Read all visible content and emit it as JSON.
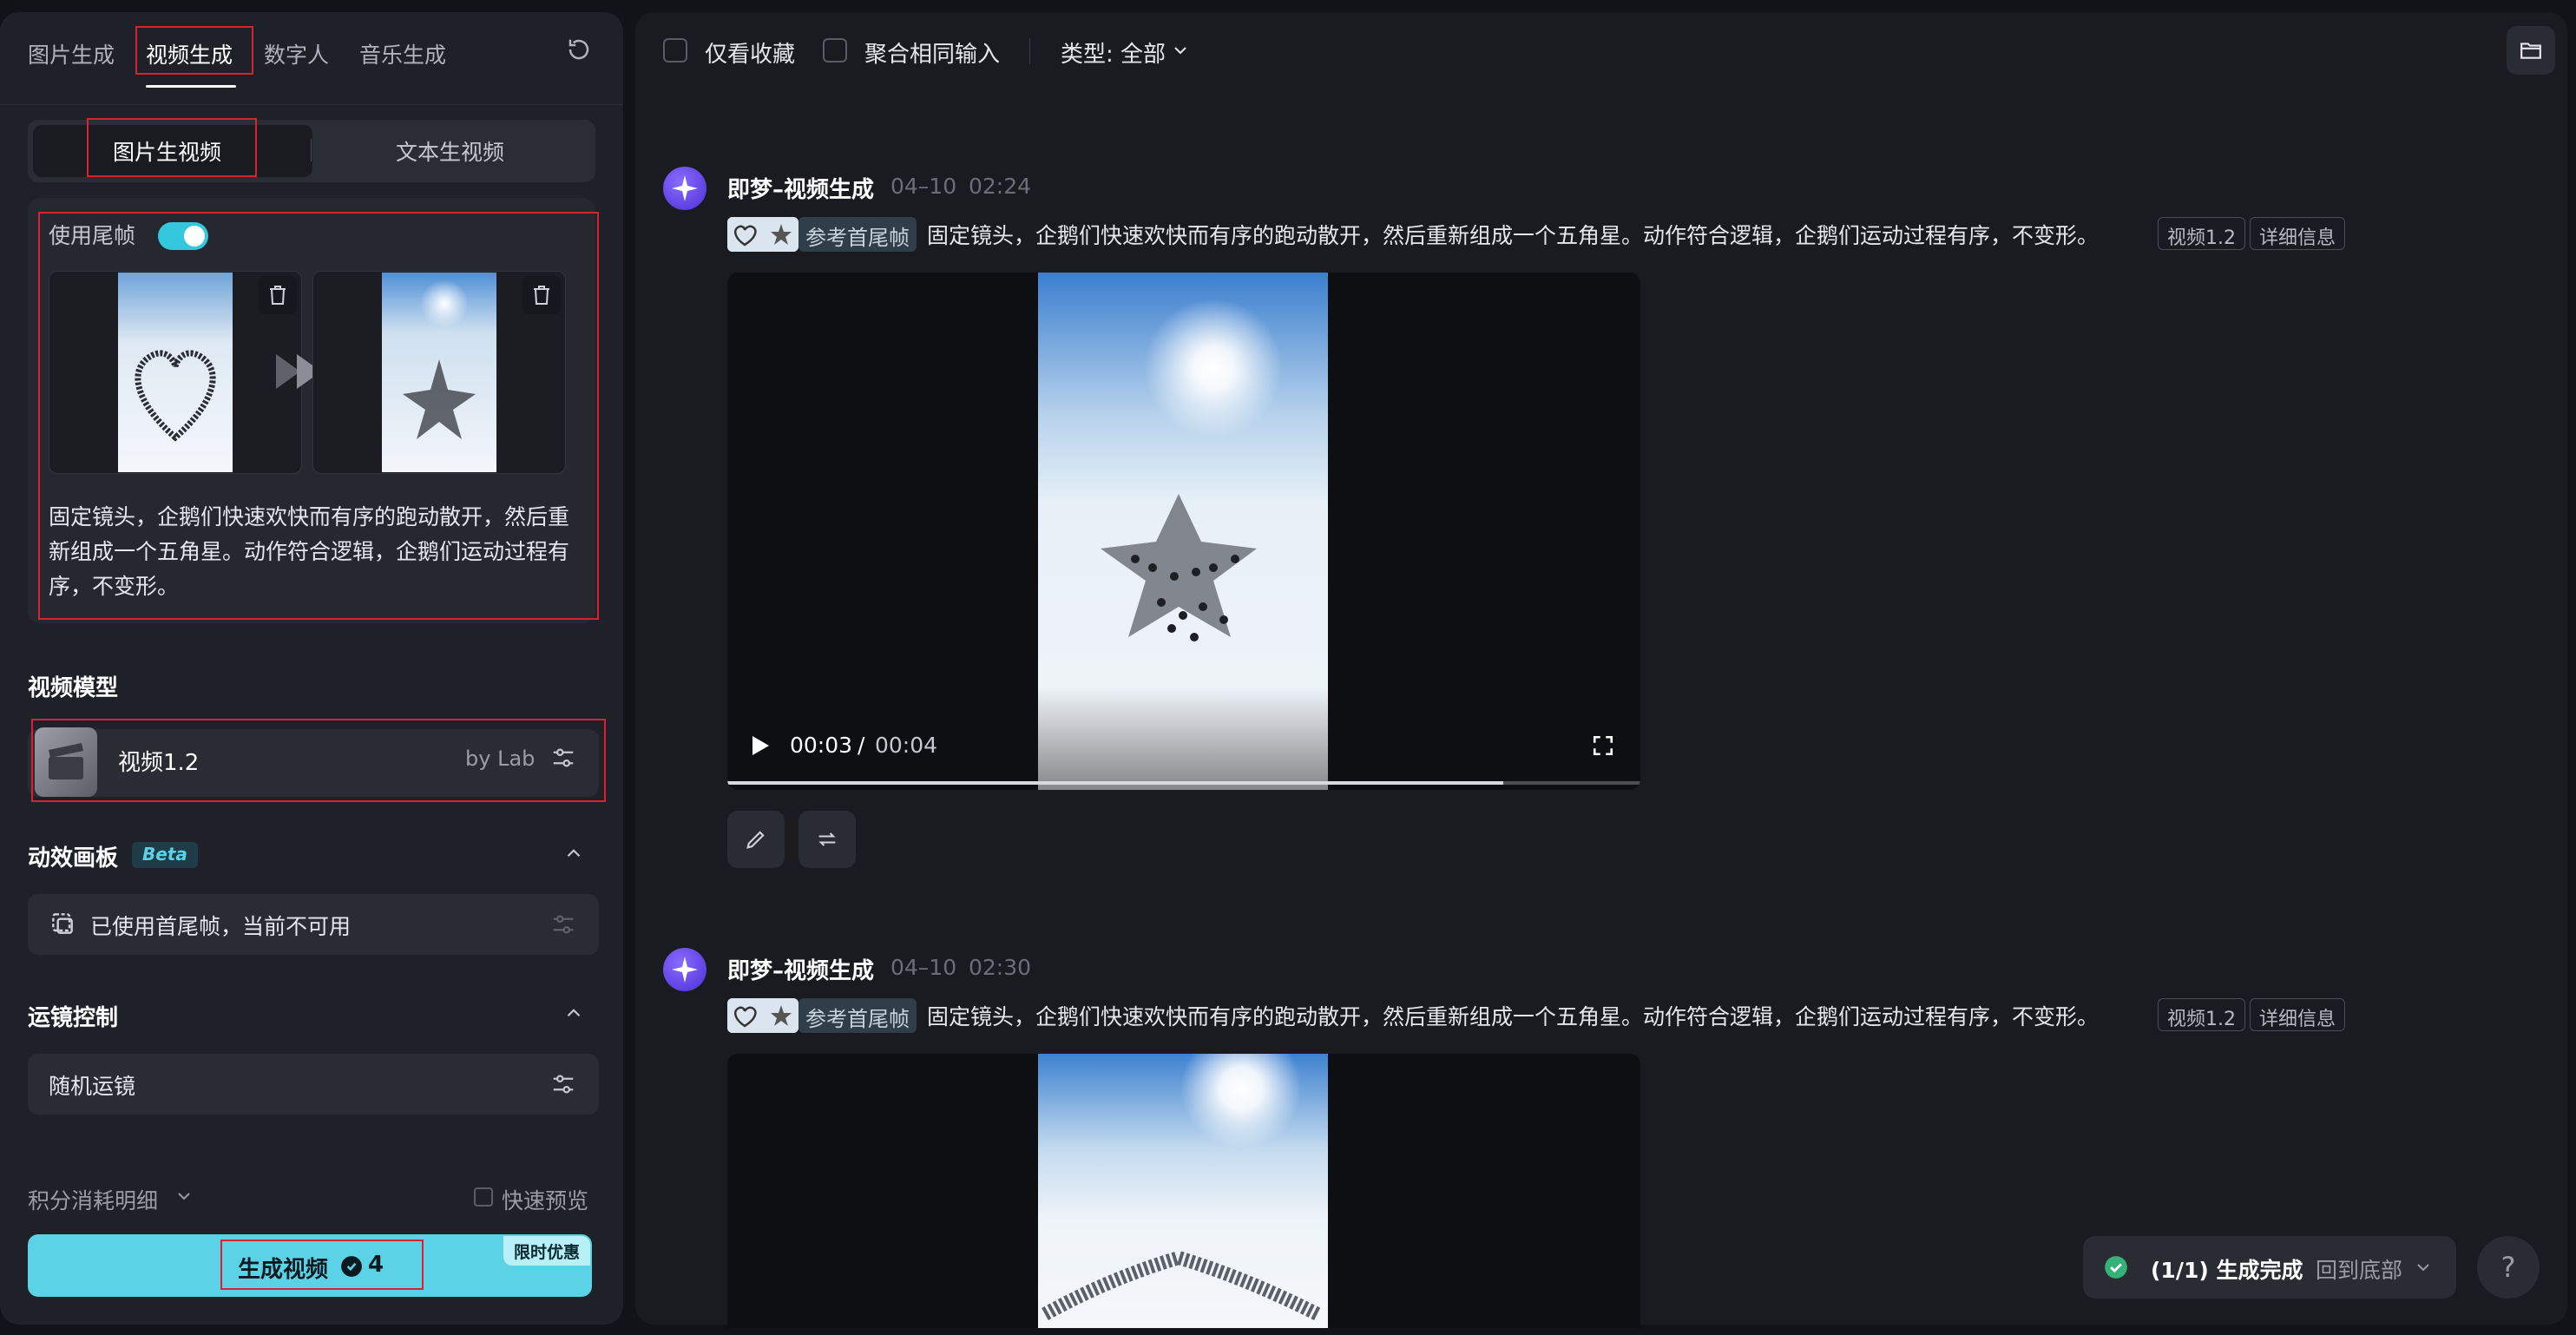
{
  "left_panel": {
    "tabs": [
      {
        "label": "图片生成",
        "active": false
      },
      {
        "label": "视频生成",
        "active": true
      },
      {
        "label": "数字人",
        "active": false
      },
      {
        "label": "音乐生成",
        "active": false
      }
    ],
    "mode_tabs": [
      {
        "label": "图片生视频",
        "active": true
      },
      {
        "label": "文本生视频",
        "active": false
      }
    ],
    "use_end_frame": {
      "label": "使用尾帧",
      "enabled": true
    },
    "prompt_text": "固定镜头，企鹅们快速欢快而有序的跑动散开，然后重新组成一个五角星。动作符合逻辑，企鹅们运动过程有序，不变形。",
    "video_model": {
      "section_title": "视频模型",
      "name": "视频1.2",
      "provider": "by Lab"
    },
    "motion_canvas": {
      "section_title": "动效画板",
      "badge": "Beta",
      "status": "已使用首尾帧，当前不可用"
    },
    "camera_control": {
      "section_title": "运镜控制",
      "value": "随机运镜"
    },
    "credits_label": "积分消耗明细",
    "fast_preview_label": "快速预览",
    "generate_button": {
      "label": "生成视频",
      "cost": "4",
      "promo": "限时优惠"
    }
  },
  "right_panel": {
    "toolbar": {
      "favorites_only": "仅看收藏",
      "group_same_input": "聚合相同输入",
      "type_filter": "类型: 全部"
    },
    "results": [
      {
        "author": "即梦–视频生成",
        "date": "04–10",
        "time": "02:24",
        "ref_tag": "参考首尾帧",
        "prompt": "固定镜头，企鹅们快速欢快而有序的跑动散开，然后重新组成一个五角星。动作符合逻辑，企鹅们运动过程有序，不变形。",
        "model_pill": "视频1.2",
        "detail_pill": "详细信息",
        "current_time": "00:03",
        "duration": "00:04",
        "progress": 0.85
      },
      {
        "author": "即梦–视频生成",
        "date": "04–10",
        "time": "02:30",
        "ref_tag": "参考首尾帧",
        "prompt": "固定镜头，企鹅们快速欢快而有序的跑动散开，然后重新组成一个五角星。动作符合逻辑，企鹅们运动过程有序，不变形。",
        "model_pill": "视频1.2",
        "detail_pill": "详细信息"
      }
    ],
    "status_toast": {
      "text": "(1/1) 生成完成",
      "action": "回到底部"
    },
    "help": "?"
  },
  "colors": {
    "accent": "#5cd2e6",
    "annotation_red": "#d6232f",
    "panel_bg": "#1f2128",
    "main_bg": "#1a1b21"
  }
}
